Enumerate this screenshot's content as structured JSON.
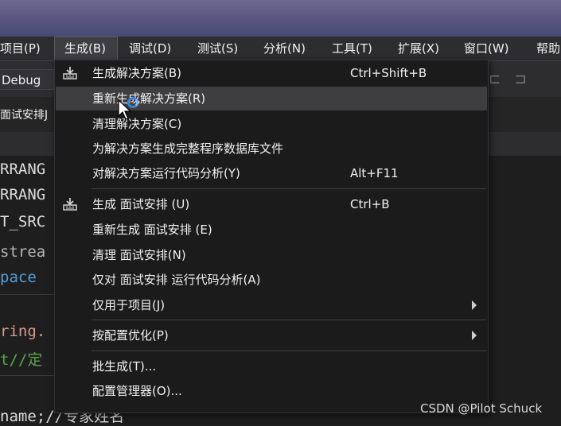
{
  "menubar": {
    "items": [
      "项目(P)",
      "生成(B)",
      "调试(D)",
      "测试(S)",
      "分析(N)",
      "工具(T)",
      "扩展(X)",
      "窗口(W)",
      "帮助"
    ],
    "active": "生成(B)"
  },
  "toolbar": {
    "config": "Debug"
  },
  "tab": {
    "title": "面试安排J"
  },
  "code": {
    "lines": [
      {
        "text": "RRANG",
        "color": "white"
      },
      {
        "text": "RRANG",
        "color": "white"
      },
      {
        "text": "T_SRC",
        "color": "white"
      },
      {
        "text": "strea",
        "color": "gray"
      },
      {
        "text": "pace",
        "color": "blue"
      },
      {
        "text": "ring.",
        "color": "orange"
      },
      {
        "text": "t//定",
        "color": "green"
      },
      {
        "text": "name;//专家姓名",
        "color": "white"
      }
    ]
  },
  "dropdown": {
    "items": [
      {
        "label": "生成解决方案(B)",
        "shortcut": "Ctrl+Shift+B",
        "icon": "build-icon"
      },
      {
        "label": "重新生成解决方案(R)",
        "shortcut": "",
        "hover": true
      },
      {
        "label": "清理解决方案(C)",
        "shortcut": ""
      },
      {
        "label": "为解决方案生成完整程序数据库文件",
        "shortcut": ""
      },
      {
        "label": "对解决方案运行代码分析(Y)",
        "shortcut": "Alt+F11"
      },
      {
        "label": "生成 面试安排 (U)",
        "shortcut": "Ctrl+B",
        "icon": "build-icon"
      },
      {
        "label": "重新生成 面试安排 (E)",
        "shortcut": ""
      },
      {
        "label": "清理 面试安排(N)",
        "shortcut": ""
      },
      {
        "label": "仅对 面试安排 运行代码分析(A)",
        "shortcut": ""
      },
      {
        "label": "仅用于项目(J)",
        "shortcut": "",
        "submenu": true
      },
      {
        "label": "按配置优化(P)",
        "shortcut": "",
        "submenu": true
      },
      {
        "label": "批生成(T)...",
        "shortcut": ""
      },
      {
        "label": "配置管理器(O)...",
        "shortcut": ""
      }
    ]
  },
  "watermark": "CSDN @Pilot Schuck",
  "colors": {
    "menu_bg": "#2d2d30",
    "dropdown_bg": "#1b1b1c",
    "hover": "#3e3e40",
    "accent": "#3a84d6"
  }
}
